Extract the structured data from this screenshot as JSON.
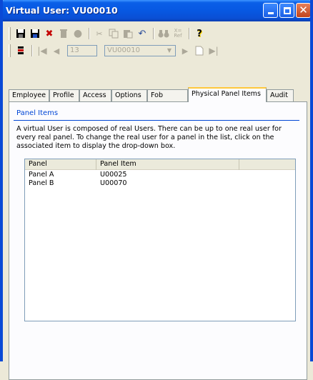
{
  "window": {
    "title": "Virtual User: VU00010"
  },
  "toolbar": {
    "record_number": "13",
    "record_combo_value": "VU00010"
  },
  "tabs": [
    {
      "label": "Employee"
    },
    {
      "label": "Profile"
    },
    {
      "label": "Access"
    },
    {
      "label": "Options"
    },
    {
      "label": "Fob"
    },
    {
      "label": "Physical Panel Items"
    },
    {
      "label": "Audit"
    }
  ],
  "active_tab": "Physical Panel Items",
  "panel": {
    "group_title": "Panel Items",
    "description": "A virtual User is composed of real Users. There can be up to one real user for every real panel. To change the real user for a panel in the list, click on the associated item to display the drop-down box."
  },
  "list": {
    "columns": [
      "Panel",
      "Panel Item"
    ],
    "rows": [
      {
        "panel": "Panel A",
        "item": "U00025"
      },
      {
        "panel": "Panel B",
        "item": "U00070"
      }
    ]
  },
  "colors": {
    "titlebar": "#0758e2",
    "tab_highlight": "#ffc83c",
    "group_title": "#0046d5",
    "close_button": "#c2431b"
  }
}
